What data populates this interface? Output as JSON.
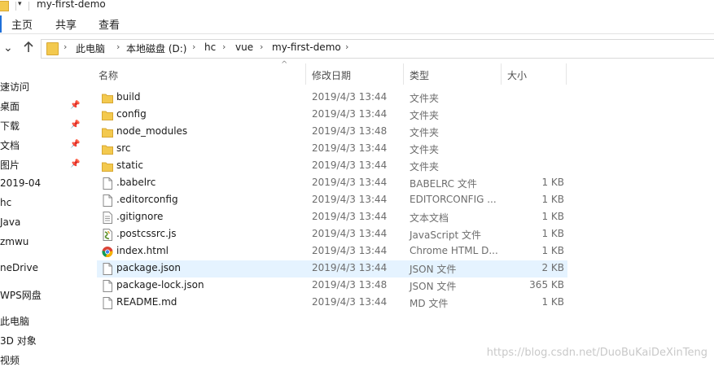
{
  "window": {
    "title": "my-first-demo"
  },
  "ribbon": {
    "tabs": [
      "主页",
      "共享",
      "查看"
    ]
  },
  "address": {
    "crumbs": [
      "此电脑",
      "本地磁盘 (D:)",
      "hc",
      "vue",
      "my-first-demo"
    ]
  },
  "nav": {
    "items": [
      {
        "label": "速访问",
        "pinned": false
      },
      {
        "label": "桌面",
        "pinned": true
      },
      {
        "label": "下载",
        "pinned": true
      },
      {
        "label": "文档",
        "pinned": true
      },
      {
        "label": "图片",
        "pinned": true
      },
      {
        "label": "2019-04",
        "pinned": false
      },
      {
        "label": "hc",
        "pinned": false
      },
      {
        "label": "Java",
        "pinned": false
      },
      {
        "label": "zmwu",
        "pinned": false
      },
      {
        "label": "neDrive",
        "pinned": false
      },
      {
        "label": "WPS网盘",
        "pinned": false
      },
      {
        "label": "此电脑",
        "pinned": false
      },
      {
        "label": "3D 对象",
        "pinned": false
      },
      {
        "label": "视频",
        "pinned": false
      }
    ]
  },
  "columns": {
    "name": "名称",
    "date": "修改日期",
    "type": "类型",
    "size": "大小"
  },
  "files": [
    {
      "name": "build",
      "date": "2019/4/3 13:44",
      "type": "文件夹",
      "size": "",
      "icon": "folder-icon"
    },
    {
      "name": "config",
      "date": "2019/4/3 13:44",
      "type": "文件夹",
      "size": "",
      "icon": "folder-icon"
    },
    {
      "name": "node_modules",
      "date": "2019/4/3 13:48",
      "type": "文件夹",
      "size": "",
      "icon": "folder-icon"
    },
    {
      "name": "src",
      "date": "2019/4/3 13:44",
      "type": "文件夹",
      "size": "",
      "icon": "folder-icon"
    },
    {
      "name": "static",
      "date": "2019/4/3 13:44",
      "type": "文件夹",
      "size": "",
      "icon": "folder-icon"
    },
    {
      "name": ".babelrc",
      "date": "2019/4/3 13:44",
      "type": "BABELRC 文件",
      "size": "1 KB",
      "icon": "blank-file-icon"
    },
    {
      "name": ".editorconfig",
      "date": "2019/4/3 13:44",
      "type": "EDITORCONFIG ...",
      "size": "1 KB",
      "icon": "blank-file-icon"
    },
    {
      "name": ".gitignore",
      "date": "2019/4/3 13:44",
      "type": "文本文档",
      "size": "1 KB",
      "icon": "text-file-icon"
    },
    {
      "name": ".postcssrc.js",
      "date": "2019/4/3 13:44",
      "type": "JavaScript 文件",
      "size": "1 KB",
      "icon": "script-file-icon"
    },
    {
      "name": "index.html",
      "date": "2019/4/3 13:44",
      "type": "Chrome HTML D...",
      "size": "1 KB",
      "icon": "chrome-icon"
    },
    {
      "name": "package.json",
      "date": "2019/4/3 13:44",
      "type": "JSON 文件",
      "size": "2 KB",
      "icon": "blank-file-icon",
      "selected": true
    },
    {
      "name": "package-lock.json",
      "date": "2019/4/3 13:48",
      "type": "JSON 文件",
      "size": "365 KB",
      "icon": "blank-file-icon"
    },
    {
      "name": "README.md",
      "date": "2019/4/3 13:44",
      "type": "MD 文件",
      "size": "1 KB",
      "icon": "blank-file-icon"
    }
  ],
  "watermark": "https://blog.csdn.net/DuoBuKaiDeXinTeng",
  "colors": {
    "selection": "#e5f3ff",
    "folder": "#f3c94e",
    "accent": "#1e6fd9"
  }
}
